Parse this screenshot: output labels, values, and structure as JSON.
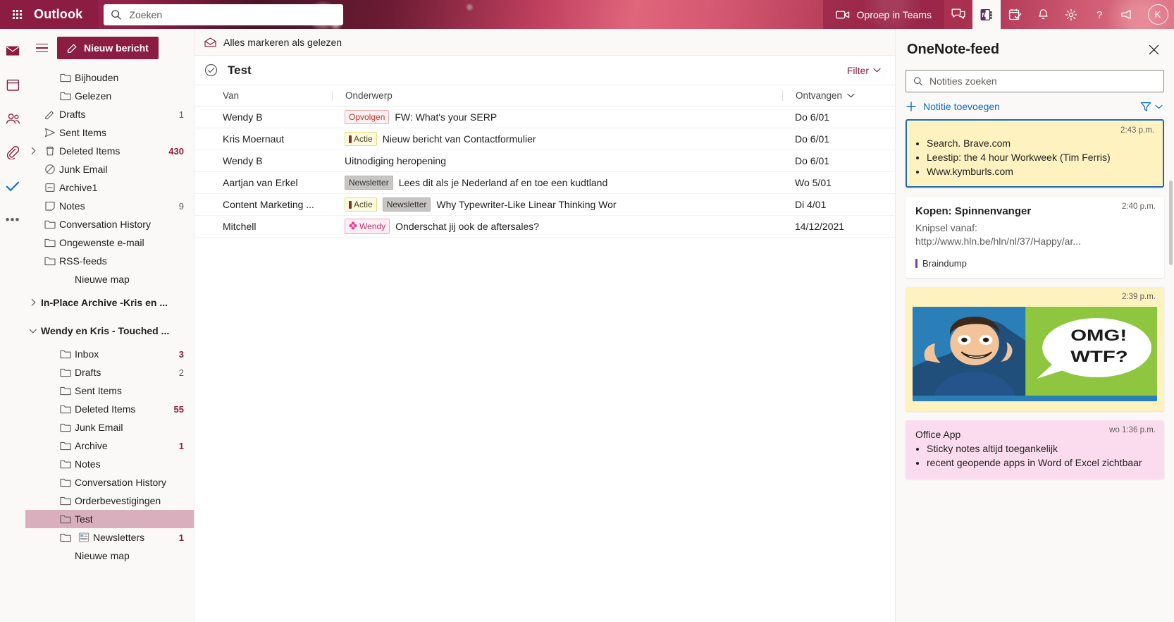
{
  "topbar": {
    "brand": "Outlook",
    "waffle_icon": "app-launcher-icon",
    "search": {
      "placeholder": "Zoeken",
      "value": "",
      "icon": "search-icon"
    },
    "teams_call": {
      "label": "Oproep in Teams",
      "icon": "video-camera-icon"
    },
    "icons": [
      {
        "name": "teams-chat-icon",
        "label": "Teams-chat"
      },
      {
        "name": "onenote-icon",
        "label": "OneNote",
        "active": true
      },
      {
        "name": "tasks-icon",
        "label": "Taken"
      },
      {
        "name": "bell-icon",
        "label": "Meldingen"
      },
      {
        "name": "gear-icon",
        "label": "Instellingen"
      },
      {
        "name": "help-icon",
        "label": "Help"
      },
      {
        "name": "feedback-icon",
        "label": "Feedback"
      }
    ],
    "avatar": {
      "initials": "K"
    }
  },
  "rail": {
    "items": [
      {
        "name": "mail-icon",
        "label": "E-mail"
      },
      {
        "name": "calendar-icon",
        "label": "Agenda"
      },
      {
        "name": "people-icon",
        "label": "Personen"
      },
      {
        "name": "files-icon",
        "label": "Bestanden"
      },
      {
        "name": "todo-icon",
        "label": "To Do"
      },
      {
        "name": "more-apps-icon",
        "label": "Meer apps"
      }
    ]
  },
  "folders": {
    "new_mail_label": "Nieuw bericht",
    "new_mail_icon": "compose-icon",
    "hamburger_icon": "hamburger-icon",
    "items": [
      {
        "label": "Bijhouden",
        "icon": "folder-icon",
        "count": "",
        "indent": "nested"
      },
      {
        "label": "Gelezen",
        "icon": "folder-icon",
        "count": "",
        "indent": "nested"
      },
      {
        "label": "Drafts",
        "icon": "pencil-icon",
        "count": "1",
        "indent": "indent-0"
      },
      {
        "label": "Sent Items",
        "icon": "send-icon",
        "count": "",
        "indent": "indent-0"
      },
      {
        "label": "Deleted Items",
        "icon": "trash-icon",
        "count": "430",
        "bold": true,
        "chevron": "chevron-right-icon",
        "indent": "indent-0"
      },
      {
        "label": "Junk Email",
        "icon": "block-icon",
        "count": "",
        "indent": "indent-0"
      },
      {
        "label": "Archive1",
        "icon": "archive-icon",
        "count": "",
        "indent": "indent-0"
      },
      {
        "label": "Notes",
        "icon": "note-icon",
        "count": "9",
        "indent": "indent-0"
      },
      {
        "label": "Conversation History",
        "icon": "folder-icon",
        "count": "",
        "indent": "indent-0"
      },
      {
        "label": "Ongewenste e-mail",
        "icon": "folder-icon",
        "count": "",
        "indent": "indent-0"
      },
      {
        "label": "RSS-feeds",
        "icon": "folder-icon",
        "count": "",
        "indent": "indent-0"
      },
      {
        "label": "Nieuwe map",
        "icon": "",
        "count": "",
        "indent": "deep"
      },
      {
        "label": "In-Place Archive -Kris en ...",
        "icon": "",
        "count": "",
        "chevron": "chevron-right-icon",
        "group": true
      },
      {
        "label": "Wendy en Kris - Touched ...",
        "icon": "",
        "count": "",
        "chevron": "chevron-down-icon",
        "group": true
      },
      {
        "label": "Inbox",
        "icon": "folder-icon",
        "count": "3",
        "bold": true,
        "indent": "nested"
      },
      {
        "label": "Drafts",
        "icon": "folder-icon",
        "count": "2",
        "indent": "nested"
      },
      {
        "label": "Sent Items",
        "icon": "folder-icon",
        "count": "",
        "indent": "nested"
      },
      {
        "label": "Deleted Items",
        "icon": "folder-icon",
        "count": "55",
        "bold": true,
        "indent": "nested"
      },
      {
        "label": "Junk Email",
        "icon": "folder-icon",
        "count": "",
        "indent": "nested"
      },
      {
        "label": "Archive",
        "icon": "folder-icon",
        "count": "1",
        "bold": true,
        "indent": "nested"
      },
      {
        "label": "Notes",
        "icon": "folder-icon",
        "count": "",
        "indent": "nested"
      },
      {
        "label": "Conversation History",
        "icon": "folder-icon",
        "count": "",
        "indent": "nested"
      },
      {
        "label": "Orderbevestigingen",
        "icon": "folder-icon",
        "count": "",
        "indent": "nested"
      },
      {
        "label": "Test",
        "icon": "folder-icon",
        "count": "",
        "indent": "nested",
        "selected": true
      },
      {
        "label": "Newsletters",
        "icon": "folder-icon",
        "count": "1",
        "bold": true,
        "indent": "nested",
        "extra_icon": "rules-icon"
      },
      {
        "label": "Nieuwe map",
        "icon": "",
        "count": "",
        "indent": "deep"
      }
    ]
  },
  "message_list": {
    "toolbar": {
      "mark_all_read": "Alles markeren als gelezen",
      "mark_icon": "envelope-open-icon"
    },
    "title": "Test",
    "title_icon": "check-circle-icon",
    "filter_label": "Filter",
    "filter_icon": "chevron-down-icon",
    "columns": {
      "from": "Van",
      "subject": "Onderwerp",
      "received": "Ontvangen",
      "sort_icon": "chevron-down-icon"
    },
    "rows": [
      {
        "from": "Wendy B",
        "categories": [
          {
            "label": "Opvolgen",
            "style": "opvolgen"
          }
        ],
        "subject": "FW: What's your SERP",
        "date": "Do 6/01"
      },
      {
        "from": "Kris Moernaut",
        "categories": [
          {
            "label": "Actie",
            "style": "actie"
          }
        ],
        "subject": "Nieuw bericht van Contactformulier",
        "date": "Do 6/01"
      },
      {
        "from": "Wendy B",
        "categories": [],
        "subject": "Uitnodiging heropening",
        "date": "Do 6/01"
      },
      {
        "from": "Aartjan van Erkel",
        "categories": [
          {
            "label": "Newsletter",
            "style": "newsletter"
          }
        ],
        "subject": "Lees dit als je Nederland af en toe een kudtland",
        "date": "Wo 5/01"
      },
      {
        "from": "Content Marketing ...",
        "categories": [
          {
            "label": "Actie",
            "style": "actie"
          },
          {
            "label": "Newsletter",
            "style": "newsletter"
          }
        ],
        "subject": "Why Typewriter-Like Linear Thinking Wor",
        "date": "Di 4/01"
      },
      {
        "from": "Mitchell",
        "categories": [
          {
            "label": "Wendy",
            "style": "wendy"
          }
        ],
        "subject": "Onderschat jij ook de aftersales?",
        "date": "14/12/2021"
      }
    ]
  },
  "onenote": {
    "title": "OneNote-feed",
    "close_icon": "close-icon",
    "search": {
      "placeholder": "Notities zoeken",
      "value": "",
      "icon": "search-icon"
    },
    "add_note_label": "Notitie toevoegen",
    "add_note_icon": "plus-icon",
    "filter_icon": "filter-icon",
    "filter_chevron_icon": "chevron-down-icon",
    "cards": [
      {
        "kind": "bullets",
        "color": "yellow",
        "selected": true,
        "time": "2:43 p.m.",
        "bullets": [
          "Search. Brave.com",
          "Leestip: the 4 hour Workweek (Tim Ferris)",
          "Www.kymburls.com"
        ]
      },
      {
        "kind": "clip",
        "color": "white",
        "time": "2:40 p.m.",
        "title": "Kopen: Spinnenvanger",
        "sub_line1": "Knipsel vanaf:",
        "sub_line2": "http://www.hln.be/hln/nl/37/Happy/ar...",
        "tag": "Braindump"
      },
      {
        "kind": "image",
        "color": "yellow2",
        "time": "2:39 p.m.",
        "image_name": "comic-omg-wtf-image",
        "caption_left": "OMG!",
        "caption_right": "WTF?"
      },
      {
        "kind": "bullets-titled",
        "color": "pink",
        "time": "wo 1:36 p.m.",
        "title_plain": "Office App",
        "bullets": [
          "Sticky notes altijd toegankelijk",
          "recent geopende apps in Word of Excel zichtbaar"
        ]
      }
    ]
  },
  "colors": {
    "brand": "#8c1d42",
    "accent_blue": "#0f6cbd",
    "selected_folder": "#d9aebd",
    "note_yellow": "#fdf2c0",
    "note_pink": "#fbdcee",
    "card_selected_border": "#1f6bb0"
  }
}
